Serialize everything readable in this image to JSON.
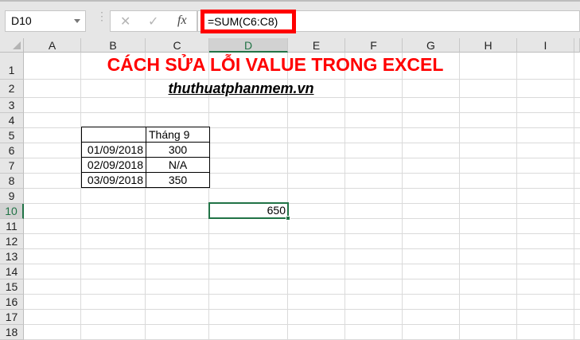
{
  "name_box": "D10",
  "formula": "=SUM(C6:C8)",
  "icons": {
    "cancel": "✕",
    "enter": "✓",
    "fx": "fx"
  },
  "columns": [
    "A",
    "B",
    "C",
    "D",
    "E",
    "F",
    "G",
    "H",
    "I"
  ],
  "rows": [
    "1",
    "2",
    "3",
    "4",
    "5",
    "6",
    "7",
    "8",
    "9",
    "10",
    "11",
    "12",
    "13",
    "14",
    "15",
    "16",
    "17",
    "18"
  ],
  "title": "CÁCH SỬA LỖI VALUE TRONG EXCEL",
  "site": "thuthuatphanmem.vn",
  "table": {
    "header": "Tháng 9",
    "rows": [
      {
        "date": "01/09/2018",
        "value": "300"
      },
      {
        "date": "02/09/2018",
        "value": "N/A"
      },
      {
        "date": "03/09/2018",
        "value": "350"
      }
    ]
  },
  "result": "650",
  "accent": "#217346"
}
